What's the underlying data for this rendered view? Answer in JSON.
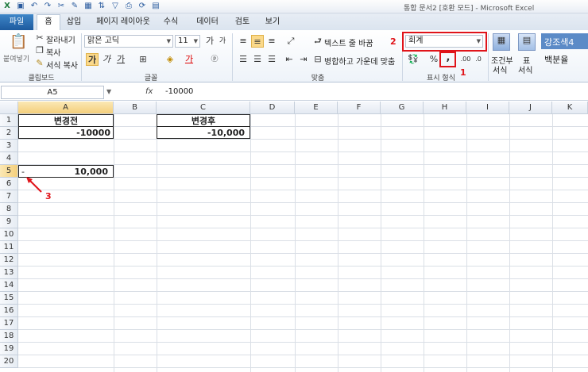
{
  "window": {
    "title": "통합 문서2 [호환 모드] - Microsoft Excel"
  },
  "tabs": [
    "파일",
    "홈",
    "삽입",
    "페이지 레이아웃",
    "수식",
    "데이터",
    "검토",
    "보기"
  ],
  "ribbon": {
    "clipboard": {
      "paste": "붙여넣기",
      "cut": "잘라내기",
      "copy": "복사",
      "format_painter": "서식 복사",
      "label": "클립보드"
    },
    "font": {
      "font_name": "맑은 고딕",
      "font_size": "11",
      "bold": "가",
      "italic": "가",
      "underline": "가",
      "label": "글꼴"
    },
    "alignment": {
      "wrap_text": "텍스트 줄 바꿈",
      "merge_center": "병합하고 가운데 맞춤",
      "label": "맞춤"
    },
    "number": {
      "format": "회계",
      "percent": "%",
      "comma": ",",
      "label": "표시 형식"
    },
    "styles": {
      "conditional": "조건부",
      "conditional2": "서식",
      "table": "표",
      "table2": "서식",
      "accent4": "강조색4",
      "percent_style": "백분율"
    },
    "annotations": {
      "n1": "1",
      "n2": "2",
      "n3": "3"
    }
  },
  "formula_bar": {
    "name_box": "A5",
    "fx": "fx",
    "value": "-10000"
  },
  "grid": {
    "columns": [
      "A",
      "B",
      "C",
      "D",
      "E",
      "F",
      "G",
      "H",
      "I",
      "J",
      "K"
    ],
    "rows": [
      "1",
      "2",
      "3",
      "4",
      "5",
      "6",
      "7",
      "8",
      "9",
      "10",
      "11",
      "12",
      "13",
      "14",
      "15",
      "16",
      "17",
      "18",
      "19",
      "20"
    ],
    "cells": {
      "A1": "변경전",
      "A2": "-10000",
      "C1": "변경후",
      "C2": "-10,000",
      "A5_sign": "-",
      "A5_value": "10,000"
    }
  },
  "colors": {
    "accent": "#e0141a",
    "file_tab": "#2b6cb4",
    "selection": "#f4cf7b"
  }
}
